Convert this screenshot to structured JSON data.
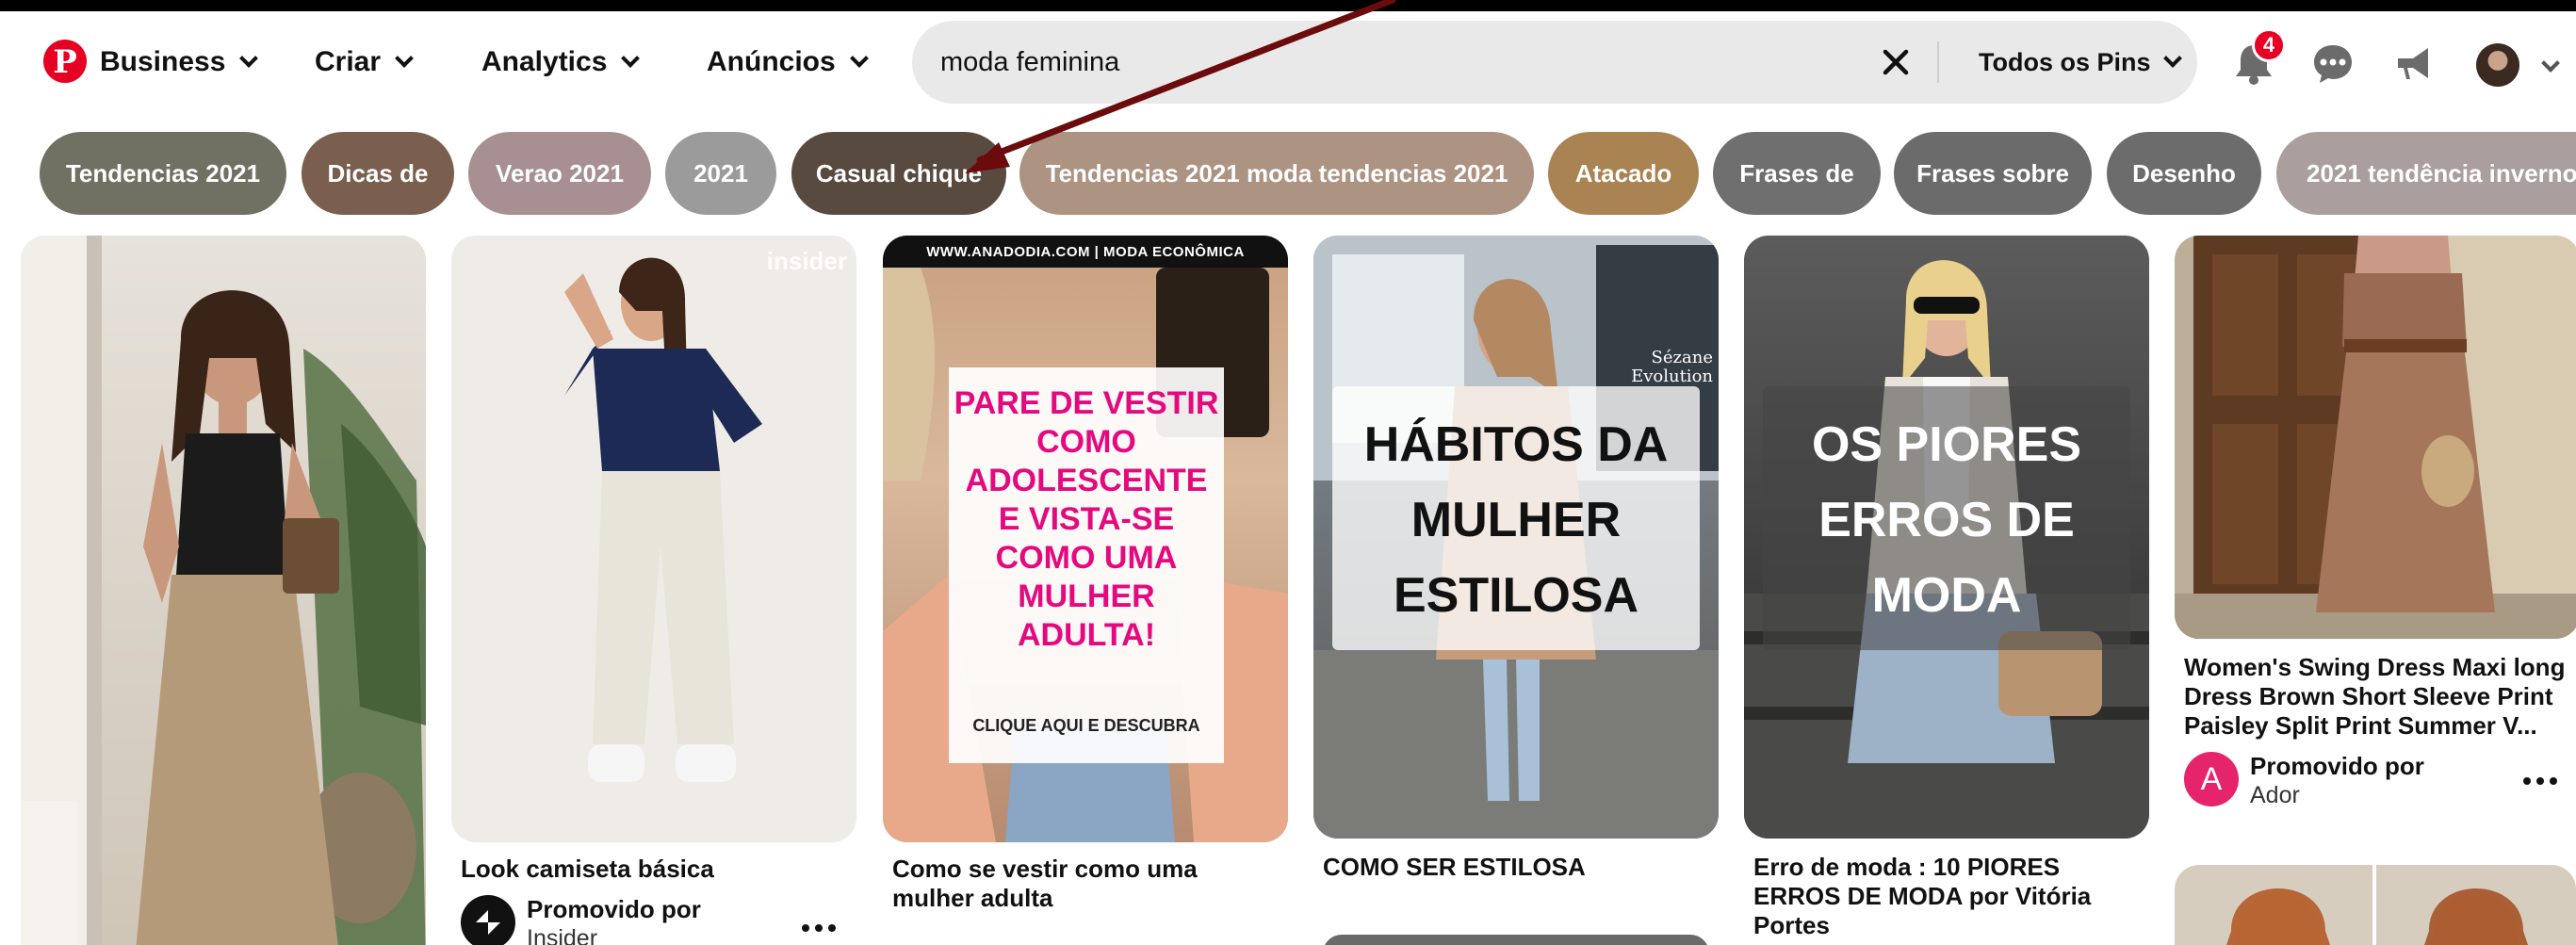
{
  "header": {
    "logo_letter": "P",
    "nav": {
      "business": "Business",
      "criar": "Criar",
      "analytics": "Analytics",
      "anuncios": "Anúncios"
    },
    "search": {
      "value": "moda feminina",
      "filter": "Todos os Pins"
    },
    "notifications_count": "4"
  },
  "chips": [
    {
      "label": "Tendencias 2021",
      "color": "#707163"
    },
    {
      "label": "Dicas de",
      "color": "#7a5f4f"
    },
    {
      "label": "Verao 2021",
      "color": "#a89092"
    },
    {
      "label": "2021",
      "color": "#9b9b9b"
    },
    {
      "label": "Casual chique",
      "color": "#584a3f"
    },
    {
      "label": "Tendencias 2021 moda tendencias 2021",
      "color": "#ad9382"
    },
    {
      "label": "Atacado",
      "color": "#a98352"
    },
    {
      "label": "Frases de",
      "color": "#6f6f6f"
    },
    {
      "label": "Frases sobre",
      "color": "#6b6b6b"
    },
    {
      "label": "Desenho",
      "color": "#6c6c6c"
    },
    {
      "label": "2021 tendência inverno",
      "color": "#aa9f9c"
    }
  ],
  "pins": {
    "pin2": {
      "watermark": "insider",
      "title": "Look camiseta básica",
      "promo_label": "Promovido por",
      "promo_name": "Insider"
    },
    "pin3": {
      "banner": "WWW.ANADODIA.COM | MODA ECONÔMICA",
      "overlay_lines": [
        "PARE DE VESTIR",
        "COMO",
        "ADOLESCENTE",
        "E VISTA-SE",
        "COMO UMA",
        "MULHER",
        "ADULTA!"
      ],
      "cta": "CLIQUE AQUI E DESCUBRA",
      "title": "Como se vestir como uma mulher adulta"
    },
    "pin4": {
      "storefront": "Sézane\nEvolution",
      "overlay_lines": [
        "HÁBITOS DA",
        "MULHER",
        "ESTILOSA"
      ],
      "title": "COMO SER ESTILOSA"
    },
    "pin5": {
      "overlay_lines": [
        "OS PIORES",
        "ERROS DE",
        "MODA"
      ],
      "title": "Erro de moda : 10 PIORES ERROS DE MODA por Vitória Portes"
    },
    "pin6": {
      "title": "Women's Swing Dress Maxi long Dress Brown Short Sleeve Print Paisley Split Print Summer V...",
      "promo_label": "Promovido por",
      "promo_name": "Ador",
      "promo_letter": "A"
    }
  },
  "colors": {
    "brand": "#e60023",
    "arrow": "#6b0b0b",
    "search_bg": "#e9e9e9",
    "pink_text": "#e5097f"
  }
}
